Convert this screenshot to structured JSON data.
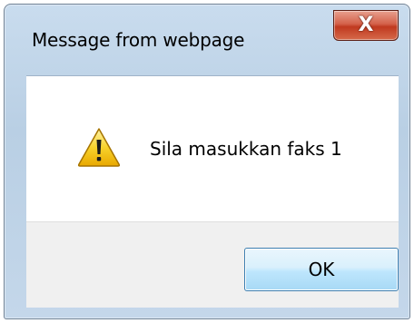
{
  "dialog": {
    "title": "Message from webpage",
    "close_label": "X",
    "icon": "warning-icon",
    "message": "Sila masukkan faks 1",
    "ok_label": "OK"
  },
  "colors": {
    "close_button": "#c0391f",
    "ok_button_border": "#3c7fb1",
    "warning_yellow": "#f2c500"
  }
}
